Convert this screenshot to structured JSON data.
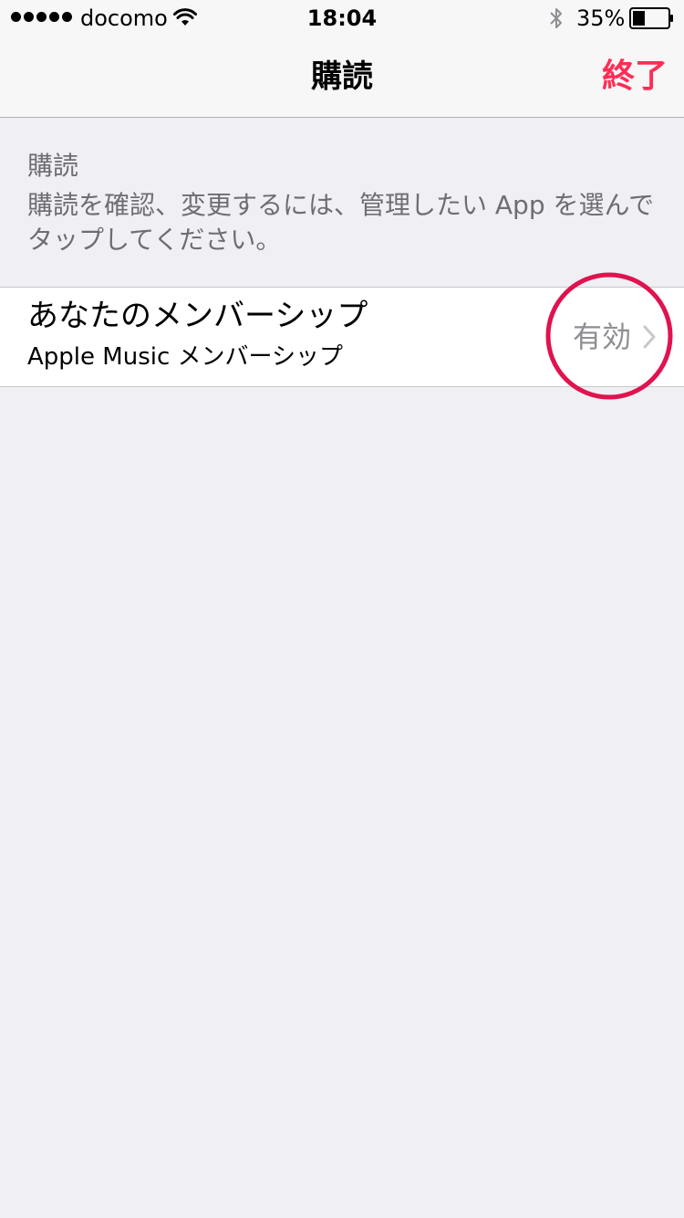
{
  "status_bar": {
    "carrier": "docomo",
    "time": "18:04",
    "battery": "35%",
    "battery_level": 0.35,
    "signal_icon": "signal-dots-icon",
    "wifi_icon": "wifi-icon",
    "bluetooth_icon": "bluetooth-icon",
    "battery_icon": "battery-icon"
  },
  "nav": {
    "title": "購読",
    "done_label": "終了"
  },
  "section": {
    "title": "購読",
    "description": "購読を確認、変更するには、管理したい App を選んでタップしてください。"
  },
  "subscription": {
    "title": "あなたのメンバーシップ",
    "subtitle": "Apple Music メンバーシップ",
    "status": "有効",
    "chevron_icon": "chevron-right-icon"
  },
  "colors": {
    "accent": "#ff2d55",
    "background": "#efeff4",
    "secondary_text": "#8e8e93",
    "highlight_ring": "#e0134f"
  }
}
